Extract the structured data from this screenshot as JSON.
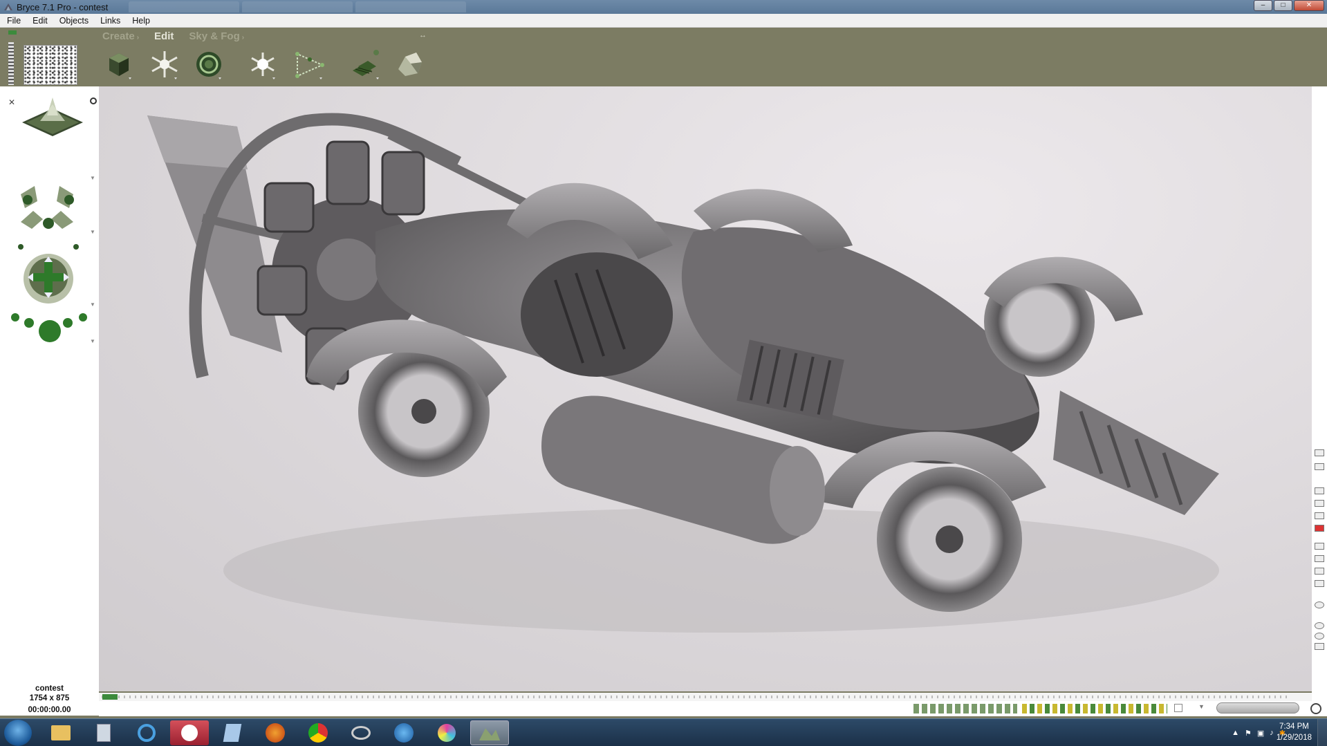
{
  "window": {
    "title": "Bryce 7.1  Pro - contest",
    "controls": {
      "minimize": "–",
      "maximize": "□",
      "close": "✕"
    }
  },
  "menu": [
    "File",
    "Edit",
    "Objects",
    "Links",
    "Help"
  ],
  "toolbar": {
    "tabs": [
      {
        "label": "Create",
        "arrow": "›",
        "active": false
      },
      {
        "label": "Edit",
        "arrow": "",
        "active": true
      },
      {
        "label": "Sky & Fog",
        "arrow": "›",
        "active": false
      }
    ],
    "collapse": "↔",
    "tools": [
      "cube-icon",
      "star-light-icon",
      "sphere-torus-icon",
      "sun-light-icon",
      "path-icon",
      "cluster-icon",
      "rock-icon"
    ]
  },
  "document": {
    "name": "contest",
    "size": "1754 x 875",
    "time": "00:00:00.00"
  },
  "taskbar": {
    "items": [
      "start-button",
      "explorer-icon",
      "calculator-icon",
      "internet-explorer-icon",
      "pinwheel-app-icon",
      "notepad-icon",
      "firefox-icon",
      "chrome-icon",
      "satellite-icon",
      "media-player-icon",
      "paint-icon",
      "bryce-icon"
    ],
    "clock_time": "7:34 PM",
    "clock_date": "1/29/2018"
  },
  "colors": {
    "toolbar_bg": "#7c7c63",
    "tab_active": "#e4e4d8",
    "tab_inactive": "#a3a38c",
    "viewport_bg": "#dcd8db",
    "accent_green": "#3c8a3c"
  }
}
